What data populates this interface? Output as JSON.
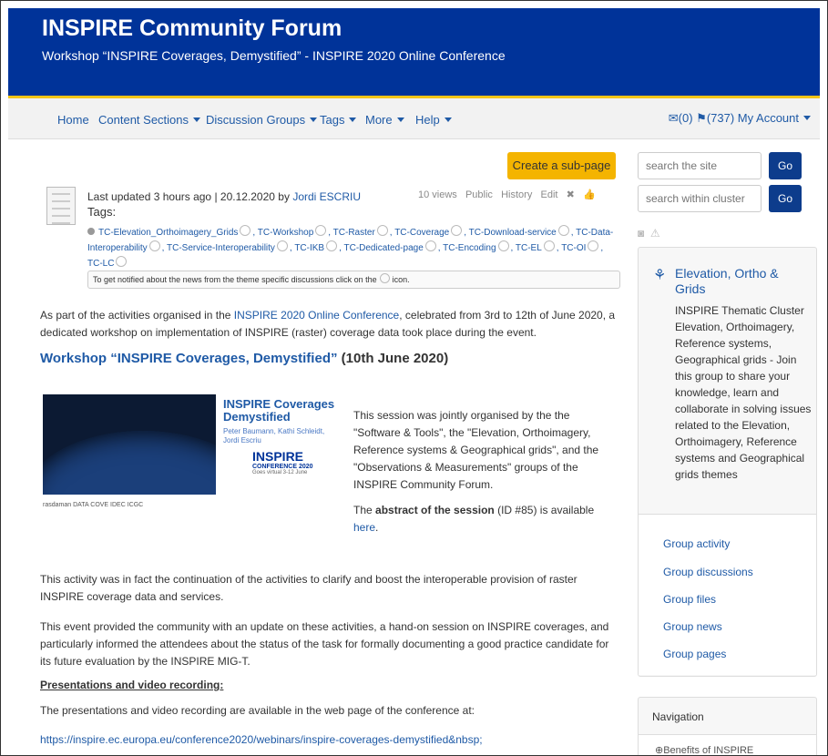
{
  "header": {
    "title": "INSPIRE Community Forum",
    "subtitle": "Workshop “INSPIRE Coverages, Demystified” - INSPIRE 2020 Online Conference"
  },
  "nav": {
    "items": [
      {
        "label": "Home",
        "dropdown": false
      },
      {
        "label": "Content Sections",
        "dropdown": true
      },
      {
        "label": "Discussion Groups",
        "dropdown": true
      },
      {
        "label": "Tags",
        "dropdown": true
      },
      {
        "label": "More",
        "dropdown": true
      },
      {
        "label": "Help",
        "dropdown": true
      }
    ],
    "messages": "(0)",
    "notifications": "(737)",
    "account": "My Account"
  },
  "page": {
    "create_subpage": "Create a sub-page",
    "last_updated": "Last updated 3 hours ago | 20.12.2020 by",
    "author": "Jordi ESCRIU",
    "tags_title": "Tags:",
    "views": "10 views",
    "visibility": "Public",
    "history": "History",
    "edit": "Edit",
    "tags": [
      "TC-Elevation_Orthoimagery_Grids",
      "TC-Workshop",
      "TC-Raster",
      "TC-Coverage",
      "TC-Download-service",
      "TC-Data-Interoperability",
      "TC-Service-Interoperability",
      "TC-IKB",
      "TC-Dedicated-page",
      "TC-Encoding",
      "TC-EL",
      "TC-OI",
      "TC-LC"
    ],
    "notify_before": "To get notified about the news from the theme specific discussions click on the",
    "notify_after": "icon.",
    "intro_1": "As part of the activities organised in the",
    "intro_link": "INSPIRE 2020 Online Conference",
    "intro_2": ", celebrated from 3rd to 12th of June 2020, a dedicated workshop on implementation of INSPIRE (raster) coverage data took place during the event.",
    "heading_link": "Workshop “INSPIRE Coverages, Demystified”",
    "heading_rest": "(10th June 2020)",
    "thumb_title_1": "INSPIRE Coverages",
    "thumb_title_2": "Demystified",
    "thumb_names": "Peter Baumann, Kathi Schleidt, Jordi Escriu",
    "thumb_logo": "INSPIRE",
    "thumb_logo_sub": "CONFERENCE 2020",
    "thumb_logo_note": "Goes virtual 3-12 June",
    "thumb_logos": "rasdaman   DATA COVE   IDEC   ICGC",
    "session_text": "This session was jointly organised by the the \"Software & Tools\", the \"Elevation, Orthoimagery, Reference systems & Geographical grids\", and the \"Observations & Measurements\" groups of the INSPIRE Community Forum.",
    "abstract_1": "The",
    "abstract_bold": "abstract of the session",
    "abstract_2": "(ID #85) is available",
    "abstract_link": "here",
    "abstract_end": ".",
    "para_activity": "This activity was in fact the continuation of the activities to clarify and boost the interoperable provision of raster INSPIRE coverage data and services.",
    "para_event": "This event provided the community with an update on these activities, a hand-on session on INSPIRE coverages, and particularly informed the attendees about the status of the task for formally documenting a good practice candidate for its future evaluation by the INSPIRE MIG-T.",
    "pres_heading": "Presentations and video recording",
    "pres_colon": ":",
    "pres_text": "The presentations and video recording are available in the web page of the conference at:",
    "pres_link": "https://inspire.ec.europa.eu/conference2020/webinars/inspire-coverages-demystified&nbsp;"
  },
  "sidebar": {
    "search_site_placeholder": "search the site",
    "search_cluster_placeholder": "search within cluster",
    "go": "Go",
    "group_title": "Elevation, Ortho & Grids",
    "group_desc": "INSPIRE Thematic Cluster Elevation, Orthoimagery, Reference systems, Geographical grids - Join this group to share your knowledge, learn and collaborate in solving issues related to the Elevation, Orthoimagery, Reference systems and Geographical grids themes",
    "links": [
      "Group activity",
      "Group discussions",
      "Group files",
      "Group news",
      "Group pages"
    ],
    "navigation_title": "Navigation",
    "navigation_first": "Benefits of INSPIRE"
  },
  "colors": {
    "header_bg": "#003399",
    "accent_yellow": "#f5c518",
    "link": "#1f5aa6",
    "button_go": "#0d3c8c",
    "button_create": "#f4b400"
  }
}
